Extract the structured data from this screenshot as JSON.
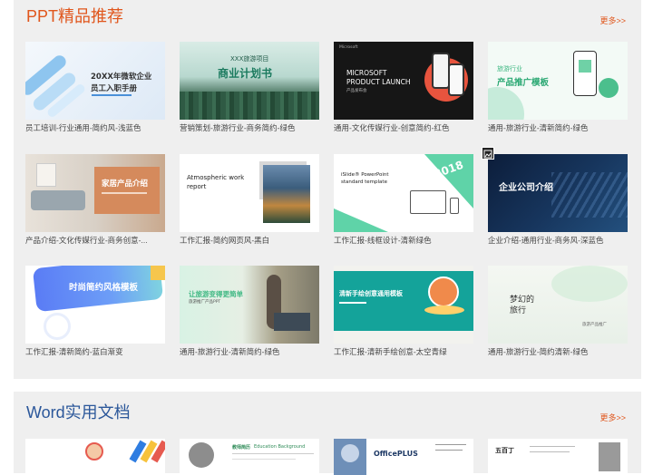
{
  "ppt": {
    "title": "PPT精品推荐",
    "more": "更多>>",
    "cards": [
      {
        "caption": "员工培训-行业通用-简约风-浅蓝色",
        "t1": "20XX年微软企业",
        "t2": "员工入职手册"
      },
      {
        "caption": "营销策划-旅游行业-商务简约-绿色",
        "t1": "XXX旅游项目",
        "t2": "商业计划书"
      },
      {
        "caption": "通用-文化传媒行业-创意简约-红色",
        "t1": "MICROSOFT",
        "t2": "PRODUCT LAUNCH",
        "t3": "产品发布会"
      },
      {
        "caption": "通用-旅游行业-清新简约-绿色",
        "t1": "旅游行业",
        "t2": "产品推广模板"
      },
      {
        "caption": "产品介绍-文化传媒行业-商务创意-...",
        "t1": "家居产品介绍"
      },
      {
        "caption": "工作汇报-简约网页风-黑白",
        "t1": "Atmospheric work",
        "t2": "report"
      },
      {
        "caption": "工作汇报-线框设计-清新绿色",
        "t1": "iSlide® PowerPoint",
        "t2": "standard template",
        "t3": "2018"
      },
      {
        "caption": "企业介绍-通用行业-商务风-深蓝色",
        "t1": "企业公司介绍"
      },
      {
        "caption": "工作汇报-清新简约-蓝白渐变",
        "t1": "时尚简约风格模板"
      },
      {
        "caption": "通用-旅游行业-清新简约-绿色",
        "t1": "让旅游变得更简单",
        "t2": "旅游推广产品PPT"
      },
      {
        "caption": "工作汇报-清新手绘创意-太空青绿",
        "t1": "清新手绘创意通用模板"
      },
      {
        "caption": "通用-旅游行业-简约清新-绿色",
        "t1": "梦幻的",
        "t2": "旅行",
        "t3": "旅游产品推广"
      }
    ]
  },
  "word": {
    "title": "Word实用文档",
    "more": "更多>>",
    "thumb2_name": "教师简历",
    "thumb2_sub": "Education Background",
    "thumb3_brand": "OfficePLUS",
    "thumb4_name": "五百丁"
  },
  "colors": {
    "ppt_accent": "#e0561c",
    "word_accent": "#2b579a",
    "panel_bg": "#efefef"
  }
}
